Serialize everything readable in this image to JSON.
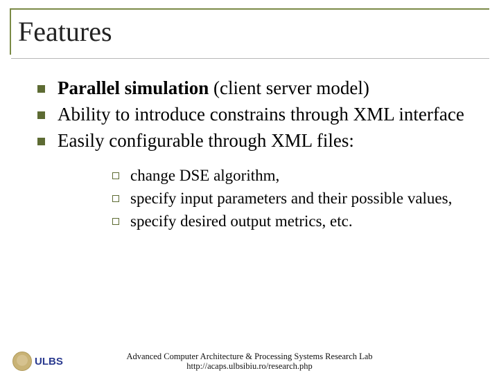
{
  "title": "Features",
  "bullets": [
    {
      "bold": "Parallel simulation",
      "rest": " (client server model)"
    },
    {
      "bold": "",
      "rest": "Ability to introduce constrains through XML interface"
    },
    {
      "bold": "",
      "rest": "Easily configurable through XML files:"
    }
  ],
  "subbullets": [
    "change DSE algorithm,",
    "specify input parameters and their possible values,",
    "specify desired output metrics, etc."
  ],
  "footer": {
    "line1": "Advanced Computer Architecture & Processing Systems Research Lab",
    "line2": "http://acaps.ulbsibiu.ro/research.php"
  },
  "logo_text": "ULBS"
}
